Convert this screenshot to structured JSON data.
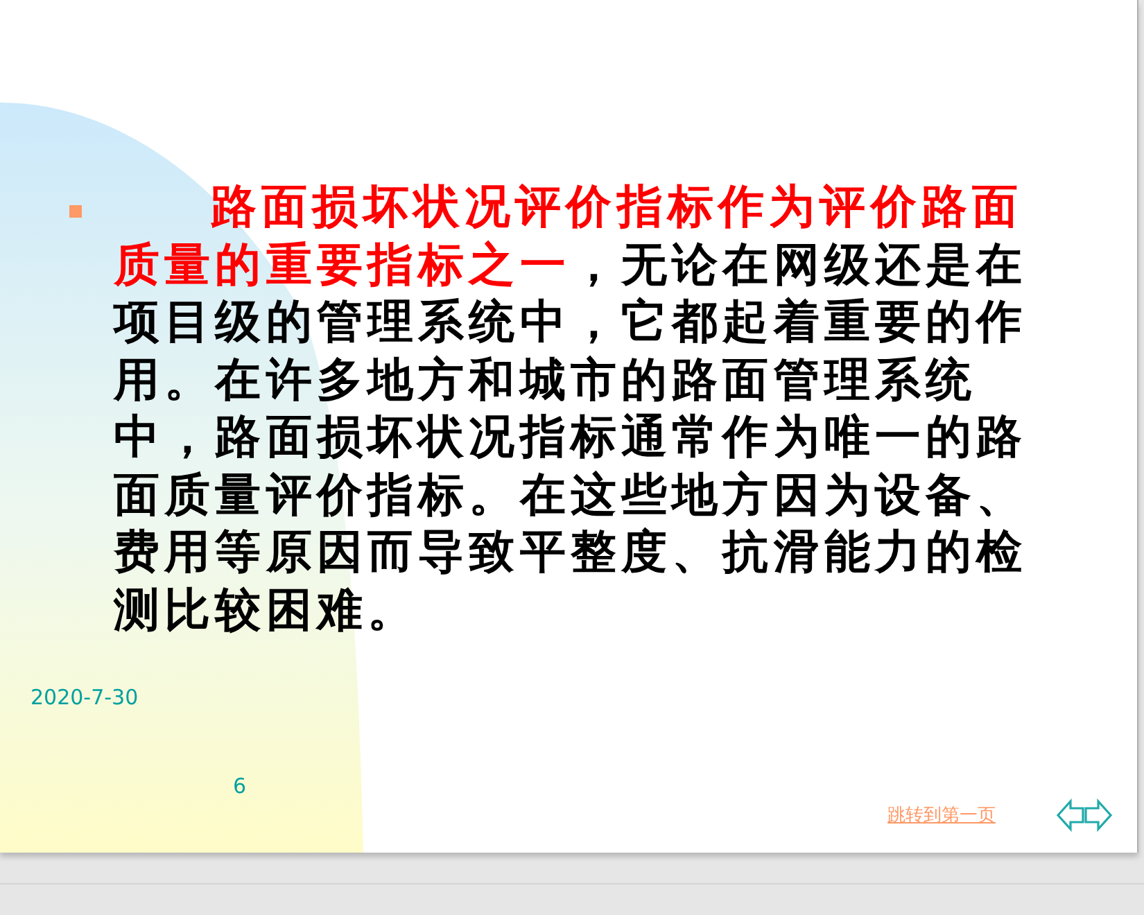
{
  "slide": {
    "bullet": {
      "highlight": "路面损坏状况评价指标作为评价路面质量的重要指标之一",
      "text": "，无论在网级还是在项目级的管理系统中，它都起着重要的作用。在许多地方和城市的路面管理系统中，路面损坏状况指标通常作为唯一的路面质量评价指标。在这些地方因为设备、费用等原因而导致平整度、抗滑能力的检测比较困难。"
    },
    "date": "2020-7-30",
    "page_number": "6",
    "link": "跳转到第一页"
  }
}
